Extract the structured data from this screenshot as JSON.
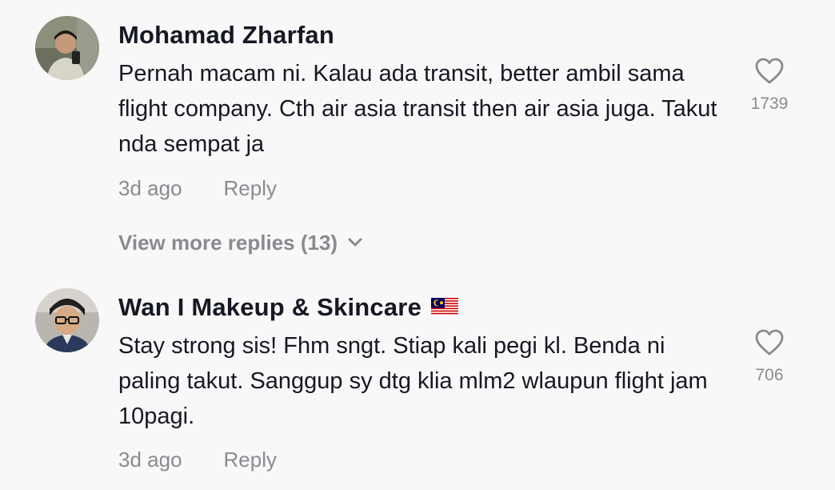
{
  "comments": [
    {
      "username": "Mohamad Zharfan",
      "text": "Pernah macam ni. Kalau ada transit, better ambil sama flight company. Cth air asia transit then air asia juga. Takut nda sempat ja",
      "time": "3d ago",
      "reply_label": "Reply",
      "likes": "1739",
      "avatar_icon": "user-avatar-photo"
    },
    {
      "username": "Wan I Makeup & Skincare",
      "flag_icon": "malaysia-flag-icon",
      "text": "Stay strong sis! Fhm sngt. Stiap kali pegi kl. Benda ni paling takut. Sanggup sy dtg klia mlm2 wlaupun flight jam 10pagi.",
      "time": "3d ago",
      "reply_label": "Reply",
      "likes": "706",
      "avatar_icon": "user-avatar-photo"
    }
  ],
  "view_more_replies": "View more replies (13)",
  "colors": {
    "background": "#f8f8f8",
    "primary_text": "#161823",
    "secondary_text": "#8a8b91"
  }
}
